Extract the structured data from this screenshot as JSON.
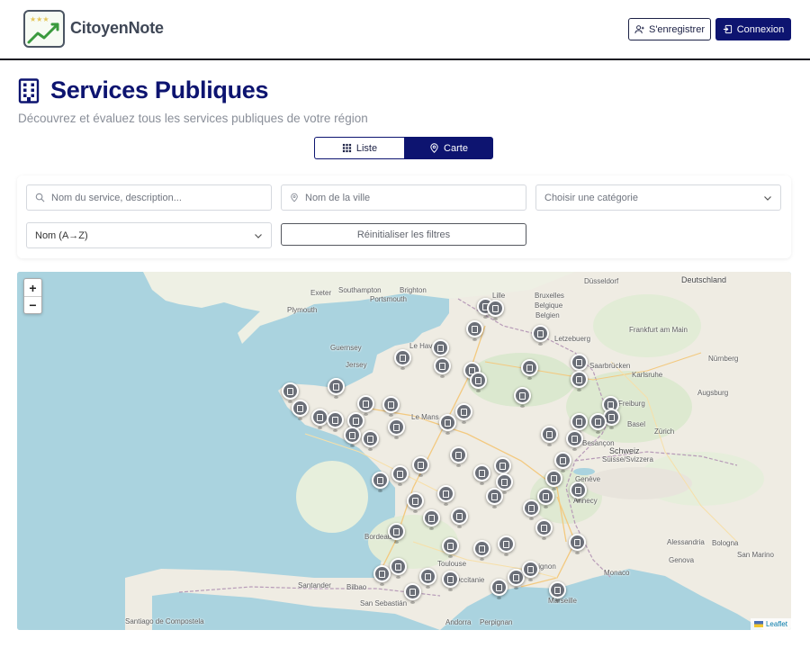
{
  "header": {
    "brand": "CitoyenNote",
    "register_label": "S'enregistrer",
    "login_label": "Connexion"
  },
  "page": {
    "title": "Services Publiques",
    "subtitle": "Découvrez et évaluez tous les services publiques de votre région"
  },
  "view_toggle": {
    "list_label": "Liste",
    "map_label": "Carte",
    "active": "Carte"
  },
  "filters": {
    "search_placeholder": "Nom du service, description...",
    "city_placeholder": "Nom de la ville",
    "category_selected": "Choisir une catégorie",
    "sort_selected": "Nom (A→Z)",
    "reset_label": "Réinitialiser les filtres"
  },
  "map": {
    "zoom_in": "+",
    "zoom_out": "−",
    "attribution": "Leaflet",
    "labels": [
      "Exeter",
      "Southampton",
      "Brighton",
      "Portsmouth",
      "Plymouth",
      "Guernsey",
      "Jersey",
      "Le Havre",
      "Le Mans",
      "Lille",
      "Bruxelles",
      "Belgique",
      "Belgien",
      "Düsseldorf",
      "Deutschland",
      "Frankfurt am Main",
      "Nürnberg",
      "Letzebuerg",
      "Saarbrücken",
      "Karlsruhe",
      "Augsburg",
      "Freiburg",
      "Basel",
      "Zürich",
      "Besançon",
      "Schweiz",
      "Suisse/Svizzera",
      "Genève",
      "Annecy",
      "Bordeaux",
      "Alessandria",
      "Genova",
      "Bologna",
      "Monaco",
      "San Marino",
      "Marseille",
      "Avignon",
      "Occitanie",
      "Santander",
      "Bilbao",
      "San Sebastián",
      "Santiago de Compostela",
      "Andorra",
      "Perpignan",
      "Toulouse"
    ],
    "marker_count": 60,
    "marker_color": "#6b6f78"
  },
  "colors": {
    "primary": "#0d1470",
    "land": "#f2efe9",
    "water": "#aad3df"
  }
}
